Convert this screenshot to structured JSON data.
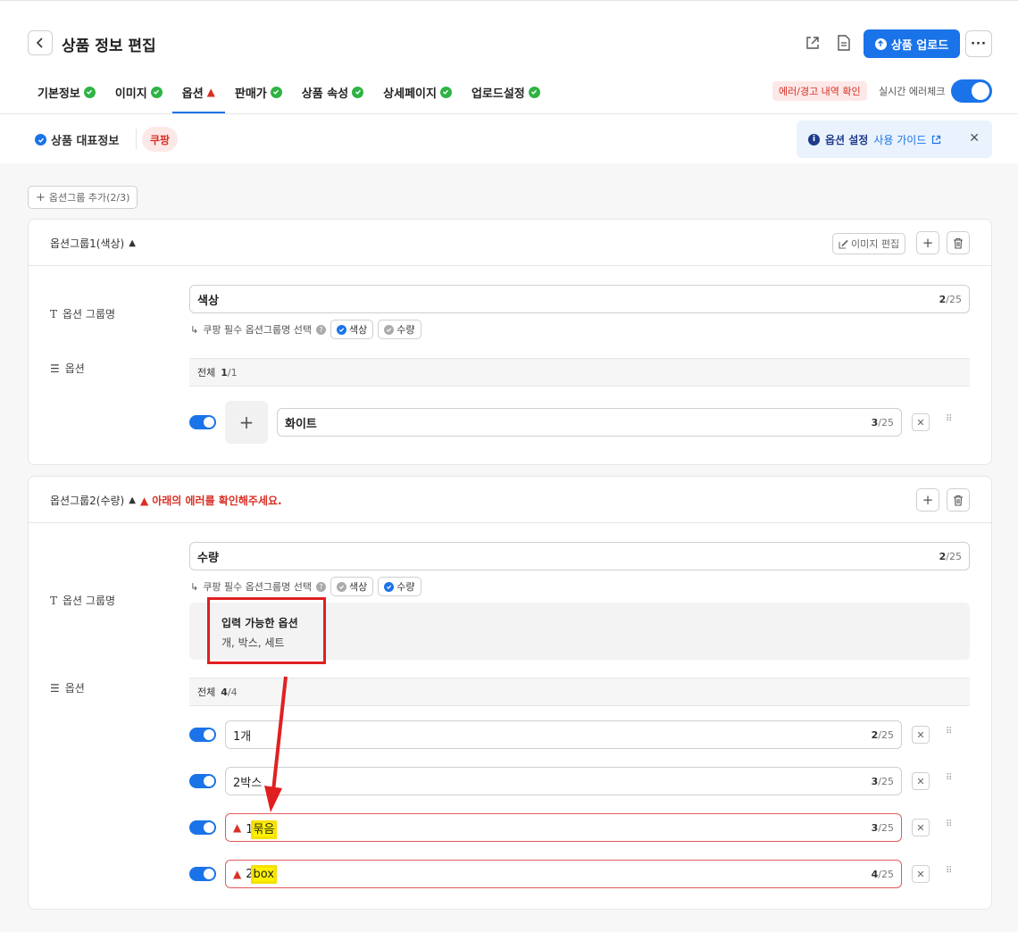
{
  "header": {
    "title": "상품 정보 편집",
    "upload_label": "상품 업로드",
    "more_label": "···"
  },
  "tabs": [
    {
      "label": "기본정보",
      "status": "ok"
    },
    {
      "label": "이미지",
      "status": "ok"
    },
    {
      "label": "옵션",
      "status": "warn",
      "active": true
    },
    {
      "label": "판매가",
      "status": "ok"
    },
    {
      "label": "상품 속성",
      "status": "ok"
    },
    {
      "label": "상세페이지",
      "status": "ok"
    },
    {
      "label": "업로드설정",
      "status": "ok"
    }
  ],
  "error_check": {
    "badge": "에러/경고 내역 확인",
    "realtime_label": "실시간 에러체크",
    "enabled": true
  },
  "subrow": {
    "rep_info": "상품 대표정보",
    "market": "쿠팡"
  },
  "guide": {
    "title": "옵션 설정",
    "link": "사용 가이드",
    "close": "✕"
  },
  "add_group": "옵션그룹 추가(2/3)",
  "group1": {
    "title": "옵션그룹1(색상)",
    "image_edit": "이미지 편집",
    "group_name_label": "옵션 그룹명",
    "options_label": "옵션",
    "name_value": "색상",
    "name_count_cur": "2",
    "name_count_max": "/25",
    "hint": "쿠팡 필수 옵션그룹명 선택",
    "chips": [
      "색상",
      "수량"
    ],
    "list_total_label": "전체",
    "list_total_cur": "1",
    "list_total_max": "/1",
    "options": [
      {
        "value": "화이트",
        "cur": "3",
        "max": "/25",
        "enabled": true
      }
    ]
  },
  "group2": {
    "title": "옵션그룹2(수량)",
    "error": "아래의 에러를 확인해주세요.",
    "group_name_label": "옵션 그룹명",
    "options_label": "옵션",
    "name_value": "수량",
    "name_count_cur": "2",
    "name_count_max": "/25",
    "hint": "쿠팡 필수 옵션그룹명 선택",
    "chips": [
      "색상",
      "수량"
    ],
    "allowed_title": "입력 가능한 옵션",
    "allowed_values": "개, 박스, 세트",
    "list_total_label": "전체",
    "list_total_cur": "4",
    "list_total_max": "/4",
    "options": [
      {
        "prefix": "1",
        "unit": "개",
        "cur": "2",
        "max": "/25",
        "error": false
      },
      {
        "prefix": "2",
        "unit": "박스",
        "cur": "3",
        "max": "/25",
        "error": false
      },
      {
        "prefix": "1",
        "unit": "묶음",
        "cur": "3",
        "max": "/25",
        "error": true
      },
      {
        "prefix": "2",
        "unit": "box",
        "cur": "4",
        "max": "/25",
        "error": true
      }
    ]
  },
  "colors": {
    "accent": "#1a73e8",
    "ok": "#2fb344",
    "error": "#d93025",
    "annotation": "#e02020",
    "highlight": "#fff200"
  }
}
